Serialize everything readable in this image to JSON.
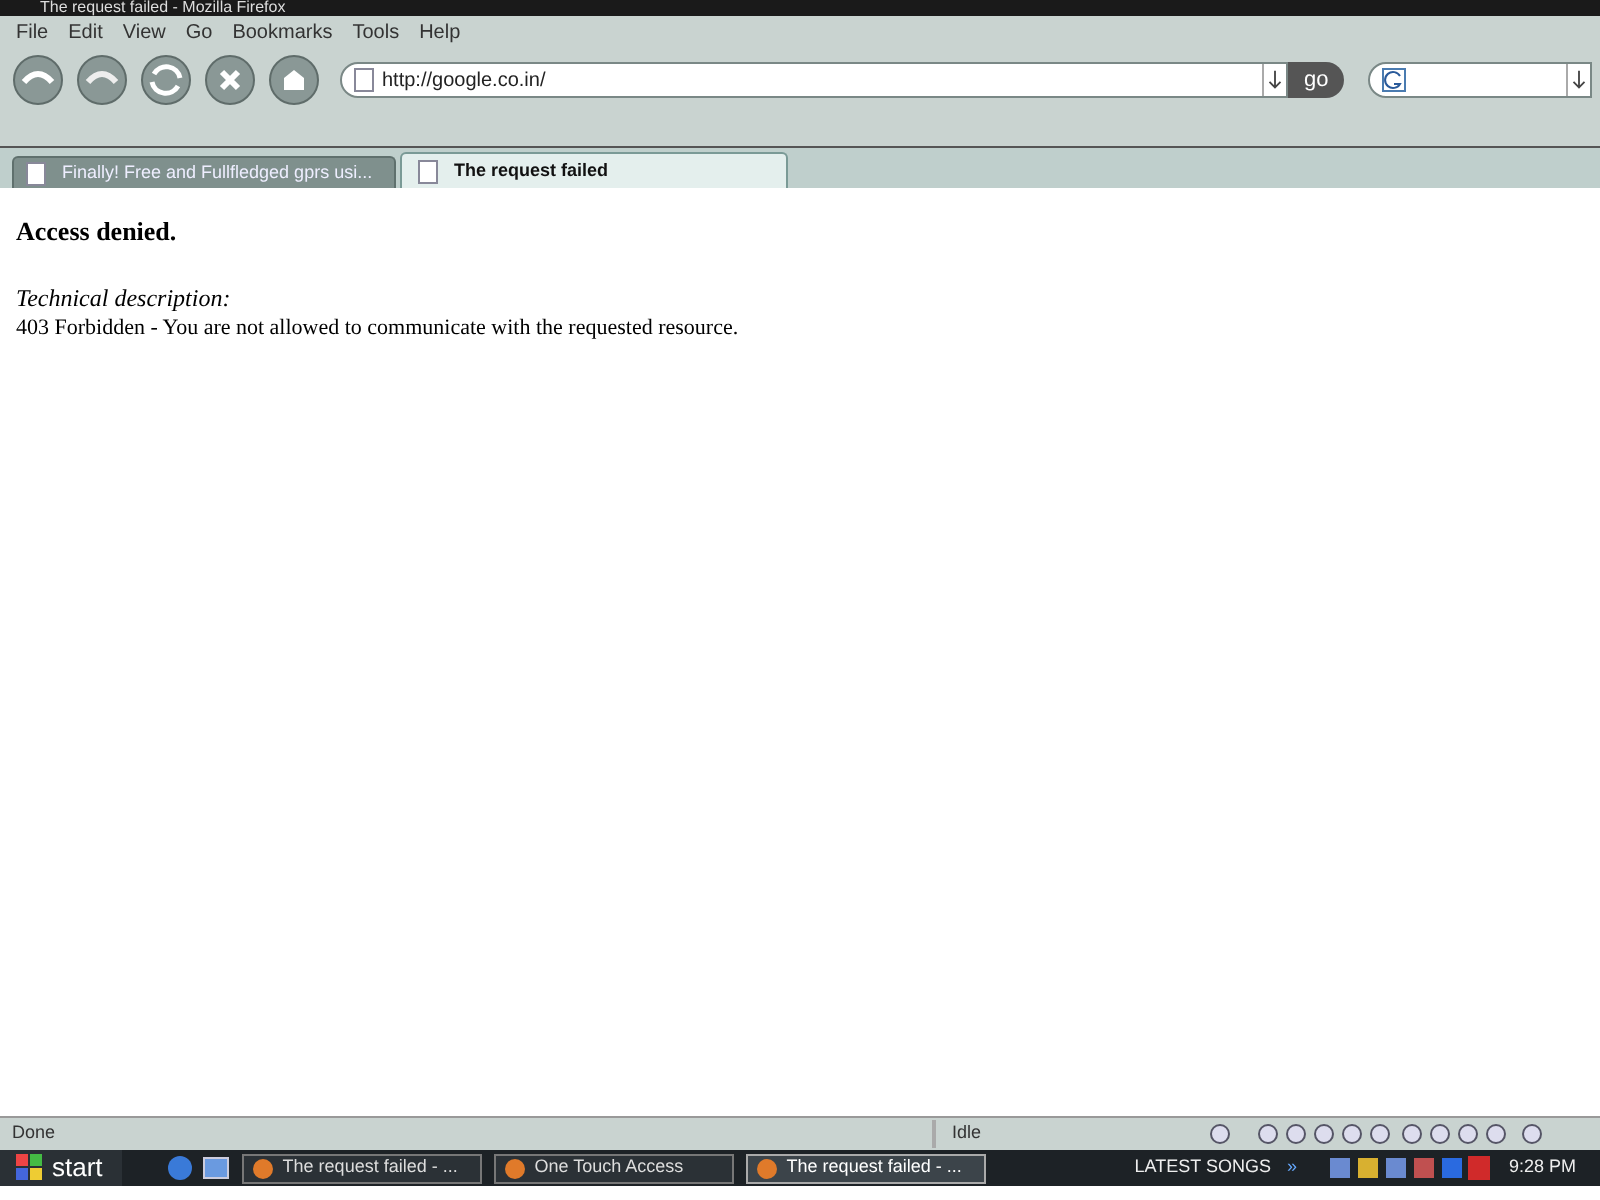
{
  "window": {
    "title": "The request failed - Mozilla Firefox"
  },
  "menu": [
    "File",
    "Edit",
    "View",
    "Go",
    "Bookmarks",
    "Tools",
    "Help"
  ],
  "address": {
    "value": "http://google.co.in/"
  },
  "go_button": "go",
  "tabs": [
    {
      "label": "Finally! Free and Fullfledged gprs usi...",
      "selected": false
    },
    {
      "label": "The request failed",
      "selected": true
    }
  ],
  "page": {
    "heading": "Access denied.",
    "description_label": "Technical description:",
    "description": "403 Forbidden - You are not allowed to communicate with the requested resource."
  },
  "status_bar": {
    "status": "Done",
    "player_status": "Idle"
  },
  "taskbar": {
    "start": "start",
    "tasks": [
      {
        "label": "The request failed - ...",
        "selected": false
      },
      {
        "label": "One Touch Access",
        "selected": false
      },
      {
        "label": "The request failed - ...",
        "selected": true
      }
    ],
    "toolbar_label": "LATEST SONGS",
    "chevron": "»",
    "clock": "9:28 PM"
  }
}
